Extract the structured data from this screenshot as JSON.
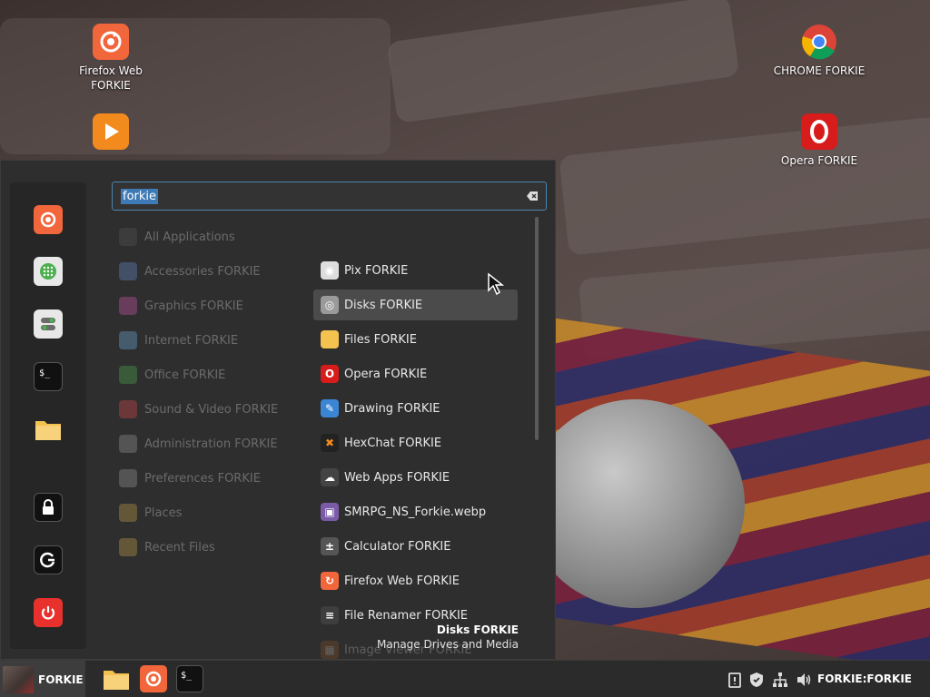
{
  "desktop": {
    "icons": [
      {
        "name": "firefox-icon",
        "label": "Firefox Web FORKIE"
      },
      {
        "name": "media-player-icon",
        "label": ""
      },
      {
        "name": "chrome-icon",
        "label": "CHROME FORKIE"
      },
      {
        "name": "opera-icon",
        "label": "Opera FORKIE"
      }
    ]
  },
  "menu": {
    "search": {
      "value": "forkie"
    },
    "sidebar": [
      {
        "name": "firefox-icon"
      },
      {
        "name": "software-manager-icon"
      },
      {
        "name": "settings-toggle-icon"
      },
      {
        "name": "terminal-icon"
      },
      {
        "name": "folder-icon"
      },
      {
        "name": "lock-icon"
      },
      {
        "name": "logout-icon"
      },
      {
        "name": "power-icon"
      }
    ],
    "categories": [
      {
        "label": "All Applications",
        "color": "#555555"
      },
      {
        "label": "Accessories FORKIE",
        "color": "#6b8bd0"
      },
      {
        "label": "Graphics FORKIE",
        "color": "#d05ab0"
      },
      {
        "label": "Internet FORKIE",
        "color": "#6fb3e8"
      },
      {
        "label": "Office FORKIE",
        "color": "#4caf50"
      },
      {
        "label": "Sound & Video FORKIE",
        "color": "#e0484a"
      },
      {
        "label": "Administration FORKIE",
        "color": "#9a9a9a"
      },
      {
        "label": "Preferences FORKIE",
        "color": "#9a9a9a"
      },
      {
        "label": "Places",
        "color": "#c9a24b"
      },
      {
        "label": "Recent Files",
        "color": "#c9a24b"
      }
    ],
    "apps": [
      {
        "label": "Pix FORKIE",
        "icon": "pix-icon",
        "color": "#ddd",
        "glyph": "◉",
        "highlighted": false
      },
      {
        "label": "Disks FORKIE",
        "icon": "disks-icon",
        "color": "#9a9a9a",
        "glyph": "◎",
        "highlighted": true
      },
      {
        "label": "Files FORKIE",
        "icon": "folder-icon",
        "color": "#f4c24f",
        "glyph": "",
        "highlighted": false
      },
      {
        "label": "Opera FORKIE",
        "icon": "opera-icon",
        "color": "#d81b1b",
        "glyph": "O",
        "highlighted": false
      },
      {
        "label": "Drawing FORKIE",
        "icon": "drawing-icon",
        "color": "#3a86d4",
        "glyph": "✎",
        "highlighted": false
      },
      {
        "label": "HexChat FORKIE",
        "icon": "hexchat-icon",
        "color": "#222",
        "glyph": "✖",
        "highlighted": false
      },
      {
        "label": "Web Apps FORKIE",
        "icon": "web-apps-icon",
        "color": "#444",
        "glyph": "☁",
        "highlighted": false
      },
      {
        "label": "SMRPG_NS_Forkie.webp",
        "icon": "image-file-icon",
        "color": "#7b5aa8",
        "glyph": "▣",
        "highlighted": false
      },
      {
        "label": "Calculator FORKIE",
        "icon": "calculator-icon",
        "color": "#555",
        "glyph": "±",
        "highlighted": false
      },
      {
        "label": "Firefox Web FORKIE",
        "icon": "firefox-icon",
        "color": "#f2663b",
        "glyph": "↻",
        "highlighted": false
      },
      {
        "label": "File Renamer FORKIE",
        "icon": "file-renamer-icon",
        "color": "#3e3e3e",
        "glyph": "≡",
        "highlighted": false
      },
      {
        "label": "Image Viewer FORKIE",
        "icon": "image-viewer-icon",
        "color": "#a45b2a",
        "glyph": "▦",
        "highlighted": false
      }
    ],
    "description": {
      "title": "Disks FORKIE",
      "subtitle": "Manage Drives and Media"
    }
  },
  "taskbar": {
    "menu_label": "FORKIE",
    "launchers": [
      {
        "name": "folder-icon"
      },
      {
        "name": "firefox-icon"
      },
      {
        "name": "terminal-icon"
      }
    ],
    "tray": [
      {
        "name": "clipboard-icon"
      },
      {
        "name": "shield-icon"
      },
      {
        "name": "network-icon"
      },
      {
        "name": "volume-icon"
      }
    ],
    "clock": "FORKIE:FORKIE"
  },
  "colors": {
    "accent": "#3d7ab6",
    "firefox": "#f2663b",
    "opera": "#d81b1b",
    "folder": "#f4c24f",
    "power": "#e8312c"
  }
}
